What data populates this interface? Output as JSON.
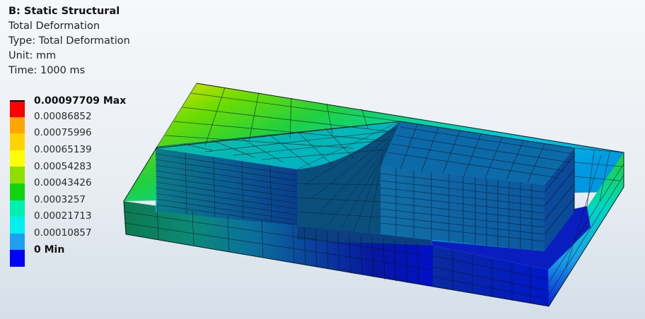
{
  "info": {
    "title": "B: Static Structural",
    "result_name": "Total Deformation",
    "type_line": "Type: Total Deformation",
    "unit_line": "Unit: mm",
    "time_line": "Time: 1000 ms"
  },
  "legend": {
    "labels": [
      "0.00097709 Max",
      "0.00086852",
      "0.00075996",
      "0.00065139",
      "0.00054283",
      "0.00043426",
      "0.0003257",
      "0.00021713",
      "0.00010857",
      "0 Min"
    ],
    "colors": [
      "#ff0000",
      "#ffa500",
      "#ffd400",
      "#ffff00",
      "#8ede00",
      "#10d410",
      "#00f0b0",
      "#00f0f0",
      "#1ea0f0",
      "#0000ff"
    ]
  },
  "model": {
    "icon": "fea-mesh-model"
  }
}
